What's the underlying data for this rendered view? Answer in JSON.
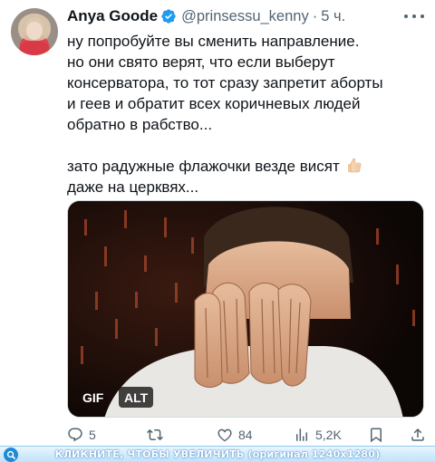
{
  "tweet": {
    "author_name": "Anya Goode",
    "handle": "@prinsessu_kenny",
    "separator": "·",
    "time": "5 ч.",
    "text_lines": [
      "ну попробуйте вы сменить направление.",
      "но они свято верят, что если выберут",
      "консерватора, то тот сразу запретит аборты",
      "и геев и обратит всех коричневых людей",
      "обратно в рабство...",
      "",
      "зато радужные флажочки везде висят",
      "даже на церквях..."
    ],
    "media": {
      "gif_label": "GIF",
      "alt_label": "ALT"
    },
    "actions": {
      "replies": "5",
      "retweets": "",
      "likes": "84",
      "views": "5,2K"
    }
  },
  "zoom_bar": {
    "text": "КЛИКНИТЕ, ЧТОБЫ УВЕЛИЧИТЬ (оригинал 1240x1280)"
  },
  "colors": {
    "verified": "#1d9bf0",
    "secondary_text": "#536471",
    "zoom_bar_accent": "#1f8ad6"
  },
  "icons": [
    "verified-badge-icon",
    "more-icon",
    "reply-icon",
    "retweet-icon",
    "like-icon",
    "views-icon",
    "bookmark-icon",
    "share-icon",
    "zoom-icon",
    "thumbs-up-emoji"
  ]
}
